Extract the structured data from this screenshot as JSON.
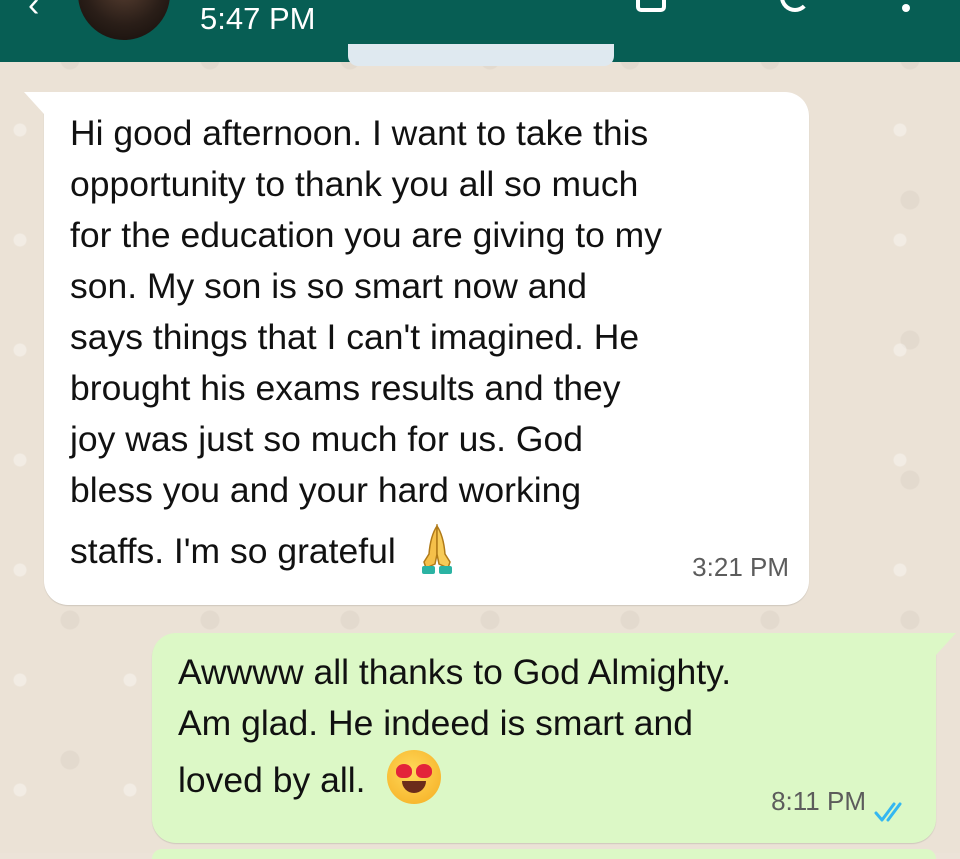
{
  "header": {
    "status_text": "5:47 PM",
    "accent_color": "#075e54"
  },
  "messages": [
    {
      "direction": "incoming",
      "lines": [
        "Hi good afternoon.  I want to take this",
        "opportunity to thank you all so much",
        "for the education you are giving to my",
        "son. My son is so smart now and",
        "says things that I can't imagined.  He",
        "brought his exams results and they",
        "joy was just so much for us. God",
        "bless you and your hard working",
        "staffs. I'm so grateful"
      ],
      "trailing_emoji": "folded-hands-emoji",
      "time": "3:21 PM"
    },
    {
      "direction": "outgoing",
      "lines": [
        "Awwww all thanks to God Almighty.",
        "Am glad. He indeed is smart and",
        "loved  by all."
      ],
      "trailing_emoji": "smiling-face-with-heart-eyes-emoji",
      "time": "8:11 PM",
      "status": "read-double-check",
      "status_color": "#34b7f1"
    }
  ]
}
